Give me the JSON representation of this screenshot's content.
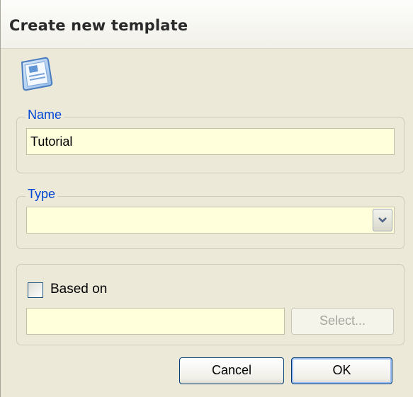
{
  "dialog": {
    "title": "Create new template"
  },
  "icons": {
    "template": "template-icon",
    "dropdown": "chevron-down-icon"
  },
  "name_group": {
    "legend": "Name",
    "value": "Tutorial"
  },
  "type_group": {
    "legend": "Type",
    "value": ""
  },
  "based_group": {
    "checkbox_label": "Based on",
    "checked": false,
    "value": "",
    "select_label": "Select..."
  },
  "buttons": {
    "cancel": "Cancel",
    "ok": "OK"
  },
  "colors": {
    "legend": "#0046d5",
    "field_background": "#ffffdc",
    "dialog_background": "#ece9d8"
  }
}
